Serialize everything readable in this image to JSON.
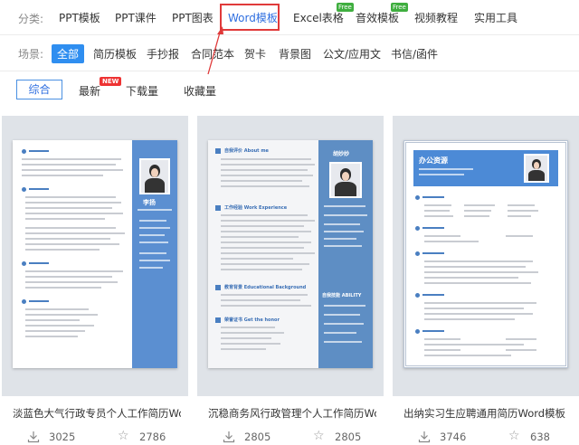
{
  "category_row": {
    "label": "分类:",
    "items": [
      {
        "label": "PPT模板",
        "active": false
      },
      {
        "label": "PPT课件",
        "active": false
      },
      {
        "label": "PPT图表",
        "active": false
      },
      {
        "label": "Word模板",
        "active": true
      },
      {
        "label": "Excel表格",
        "active": false,
        "badge": "Free"
      },
      {
        "label": "音效模板",
        "active": false,
        "badge": "Free"
      },
      {
        "label": "视频教程",
        "active": false
      },
      {
        "label": "实用工具",
        "active": false
      }
    ]
  },
  "scene_row": {
    "label": "场景:",
    "items": [
      "全部",
      "简历模板",
      "手抄报",
      "合同范本",
      "贺卡",
      "背景图",
      "公文/应用文",
      "书信/函件"
    ]
  },
  "sort_row": {
    "items": [
      "综合",
      "最新",
      "下载量",
      "收藏量"
    ],
    "new_badge": "NEW"
  },
  "cards": [
    {
      "title": "淡蓝色大气行政专员个人工作简历Wo...",
      "downloads": "3025",
      "stars": "2786",
      "doc": {
        "name": "李扬"
      }
    },
    {
      "title": "沉稳商务风行政管理个人工作简历Wo...",
      "downloads": "2805",
      "stars": "2805",
      "doc": {
        "name": "胡妙妙",
        "section1": "自我评价 About me",
        "section2": "工作经验 Work Experience",
        "section3": "教育背景 Educational Background",
        "section4": "荣誉证书 Get the honor",
        "skills": "自我技能 ABILITY"
      }
    },
    {
      "title": "出纳实习生应聘通用简历Word模板",
      "downloads": "3746",
      "stars": "638",
      "doc": {
        "heading": "办公资源"
      }
    }
  ],
  "colors": {
    "accent": "#2f6fe0",
    "highlight_box": "#e03a3a",
    "free_badge": "#3fae3f",
    "new_badge": "#e33333",
    "resume_blue": "#4a7fc1"
  }
}
